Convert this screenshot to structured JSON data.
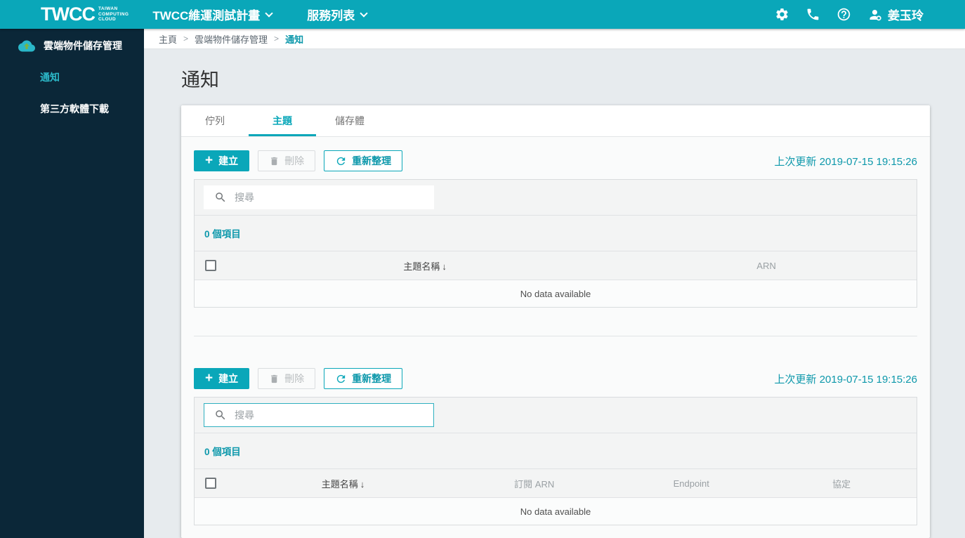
{
  "topbar": {
    "logo": {
      "main": "TWCC",
      "sub": [
        "TAIWAN",
        "COMPUTING",
        "CLOUD"
      ]
    },
    "menus": [
      {
        "label": "TWCC維運測試計畫"
      },
      {
        "label": "服務列表"
      }
    ],
    "user_name": "姜玉玲"
  },
  "sidebar": {
    "title": "雲端物件儲存管理",
    "items": [
      {
        "label": "通知",
        "active": true
      },
      {
        "label": "第三方軟體下載",
        "active": false
      }
    ]
  },
  "breadcrumb": {
    "separator": ">",
    "items": [
      "主頁",
      "雲端物件儲存管理",
      "通知"
    ]
  },
  "page_title": "通知",
  "tabs": [
    {
      "label": "佇列",
      "active": false
    },
    {
      "label": "主題",
      "active": true
    },
    {
      "label": "儲存體",
      "active": false
    }
  ],
  "icons": {
    "plus": "+",
    "sort_desc": "↓"
  },
  "sections": [
    {
      "buttons": {
        "create": "建立",
        "delete": "刪除",
        "refresh": "重新整理"
      },
      "last_updated_label": "上次更新",
      "last_updated_time": "2019-07-15 19:15:26",
      "search_placeholder": "搜尋",
      "item_count": "0 個項目",
      "columns": [
        "主題名稱",
        "ARN"
      ],
      "empty_text": "No data available"
    },
    {
      "buttons": {
        "create": "建立",
        "delete": "刪除",
        "refresh": "重新整理"
      },
      "last_updated_label": "上次更新",
      "last_updated_time": "2019-07-15 19:15:26",
      "search_placeholder": "搜尋",
      "item_count": "0 個項目",
      "columns": [
        "主題名稱",
        "訂閱 ARN",
        "Endpoint",
        "協定"
      ],
      "empty_text": "No data available"
    }
  ],
  "colors": {
    "topbar_teal": "#0aa7b9",
    "teal_text": "#0d98ab",
    "sidebar_navy": "#0b2738",
    "content_bg": "#e7ebee"
  }
}
